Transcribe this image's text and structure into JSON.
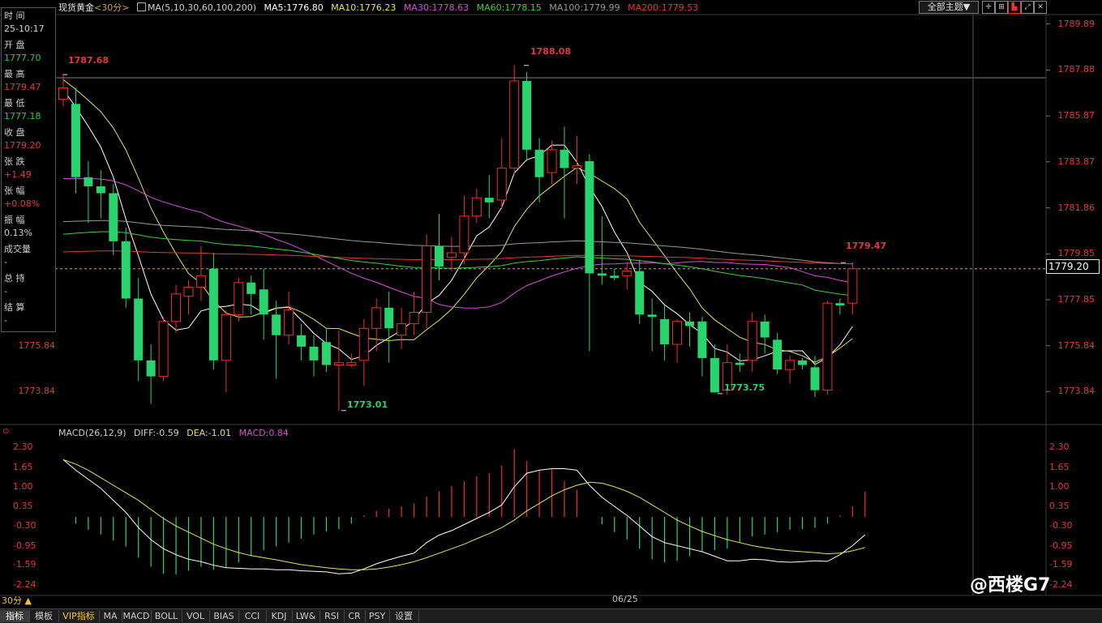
{
  "instrument": "现货黄金",
  "period_tag": "<30分>",
  "legend": {
    "ma_header": "MA(5,10,30,60,100,200)",
    "items": [
      {
        "label": "MA5:1776.80",
        "color": "#ffffff"
      },
      {
        "label": "MA10:1776.23",
        "color": "#e8e35c"
      },
      {
        "label": "MA30:1778.63",
        "color": "#d84fd8"
      },
      {
        "label": "MA60:1778.15",
        "color": "#3fcf3f"
      },
      {
        "label": "MA100:1779.99",
        "color": "#9a9a9a"
      },
      {
        "label": "MA200:1779.53",
        "color": "#e03a3a"
      }
    ]
  },
  "theme_button": "全部主题▼",
  "info_panel": {
    "rows": [
      {
        "label": "时 间",
        "value": "25-10:17",
        "color": "#d0d0d0"
      },
      {
        "label": "开 盘",
        "value": "1777.70",
        "color": "#33cc33"
      },
      {
        "label": "最 高",
        "value": "1779.47",
        "color": "#e03a3a"
      },
      {
        "label": "最 低",
        "value": "1777.18",
        "color": "#33cc33"
      },
      {
        "label": "收 盘",
        "value": "1779.20",
        "color": "#e03a3a"
      },
      {
        "label": "张 跌",
        "value": "+1.49",
        "color": "#e03a3a"
      },
      {
        "label": "张 幅",
        "value": "+0.08%",
        "color": "#e03a3a"
      },
      {
        "label": "振 幅",
        "value": "0.13%",
        "color": "#d0d0d0"
      },
      {
        "label": "成交量",
        "value": "-",
        "color": "#d0d0d0"
      },
      {
        "label": "总 持",
        "value": "-",
        "color": "#d0d0d0"
      },
      {
        "label": "结 算",
        "value": "-",
        "color": "#d0d0d0"
      }
    ]
  },
  "price_axis": [
    "1789.89",
    "1787.88",
    "1785.87",
    "1783.87",
    "1781.86",
    "1779.85",
    "1777.85",
    "1775.84",
    "1773.84"
  ],
  "current_price": "1779.20",
  "annotations": {
    "high_left": "1787.68",
    "high_mid": "1788.08",
    "low_left": "1773.01",
    "low_right": "1773.75",
    "last_high": "1779.47"
  },
  "macd": {
    "header": "MACD(26,12,9)",
    "diff": "DIFF:-0.59",
    "dea": "DEA:-1.01",
    "macd": "MACD:0.84",
    "axis": [
      "2.30",
      "1.65",
      "1.00",
      "0.35",
      "-0.30",
      "-0.95",
      "-1.59",
      "-2.24"
    ]
  },
  "date_label": "06/25",
  "period_label": "30分 ▲",
  "tabs": [
    "指标",
    "模板",
    "VIP指标",
    "MA",
    "MACD",
    "BOLL",
    "VOL",
    "BIAS",
    "CCI",
    "KDJ",
    "LW&",
    "RSI",
    "CR",
    "PSY",
    "设置"
  ],
  "watermark": "@西楼G7",
  "chart_data": {
    "type": "candlestick",
    "title": "现货黄金 30分",
    "price_range": [
      1772.4,
      1790.3
    ],
    "candles": [
      {
        "o": 1786.6,
        "h": 1787.7,
        "c": 1787.1,
        "l": 1786.3
      },
      {
        "o": 1786.4,
        "h": 1787.1,
        "c": 1783.2,
        "l": 1782.5
      },
      {
        "o": 1783.2,
        "h": 1783.9,
        "c": 1782.8,
        "l": 1781.2
      },
      {
        "o": 1782.8,
        "h": 1783.5,
        "c": 1782.5,
        "l": 1781.4
      },
      {
        "o": 1782.5,
        "h": 1782.9,
        "c": 1780.4,
        "l": 1779.8
      },
      {
        "o": 1780.4,
        "h": 1781.0,
        "c": 1777.9,
        "l": 1777.5
      },
      {
        "o": 1777.9,
        "h": 1778.8,
        "c": 1775.2,
        "l": 1774.3
      },
      {
        "o": 1775.2,
        "h": 1775.9,
        "c": 1774.5,
        "l": 1773.3
      },
      {
        "o": 1774.5,
        "h": 1777.1,
        "c": 1776.9,
        "l": 1774.3
      },
      {
        "o": 1776.9,
        "h": 1778.5,
        "c": 1778.1,
        "l": 1776.4
      },
      {
        "o": 1778.0,
        "h": 1778.7,
        "c": 1778.4,
        "l": 1777.2
      },
      {
        "o": 1778.4,
        "h": 1780.2,
        "c": 1778.9,
        "l": 1777.8
      },
      {
        "o": 1779.2,
        "h": 1779.9,
        "c": 1775.2,
        "l": 1774.8
      },
      {
        "o": 1775.2,
        "h": 1777.4,
        "c": 1777.2,
        "l": 1773.8
      },
      {
        "o": 1777.2,
        "h": 1778.8,
        "c": 1778.6,
        "l": 1776.9
      },
      {
        "o": 1778.6,
        "h": 1778.9,
        "c": 1778.1,
        "l": 1777.2
      },
      {
        "o": 1778.3,
        "h": 1779.2,
        "c": 1777.2,
        "l": 1776.1
      },
      {
        "o": 1777.2,
        "h": 1777.8,
        "c": 1776.3,
        "l": 1774.4
      },
      {
        "o": 1776.3,
        "h": 1778.2,
        "c": 1777.4,
        "l": 1775.9
      },
      {
        "o": 1776.3,
        "h": 1776.8,
        "c": 1775.8,
        "l": 1775.2
      },
      {
        "o": 1775.8,
        "h": 1776.3,
        "c": 1775.2,
        "l": 1774.5
      },
      {
        "o": 1776.0,
        "h": 1776.6,
        "c": 1775.0,
        "l": 1774.7
      },
      {
        "o": 1775.0,
        "h": 1776.5,
        "c": 1775.1,
        "l": 1773.0
      },
      {
        "o": 1775.0,
        "h": 1775.5,
        "c": 1775.1,
        "l": 1774.9
      },
      {
        "o": 1775.2,
        "h": 1777.0,
        "c": 1776.6,
        "l": 1774.1
      },
      {
        "o": 1776.6,
        "h": 1777.9,
        "c": 1777.5,
        "l": 1775.6
      },
      {
        "o": 1777.5,
        "h": 1778.2,
        "c": 1776.6,
        "l": 1775.1
      },
      {
        "o": 1776.3,
        "h": 1777.5,
        "c": 1776.8,
        "l": 1775.7
      },
      {
        "o": 1776.8,
        "h": 1778.2,
        "c": 1777.3,
        "l": 1776.3
      },
      {
        "o": 1777.3,
        "h": 1780.7,
        "c": 1780.2,
        "l": 1776.6
      },
      {
        "o": 1780.2,
        "h": 1781.6,
        "c": 1779.3,
        "l": 1778.7
      },
      {
        "o": 1779.7,
        "h": 1780.6,
        "c": 1779.9,
        "l": 1779.1
      },
      {
        "o": 1779.9,
        "h": 1782.4,
        "c": 1781.5,
        "l": 1779.4
      },
      {
        "o": 1781.5,
        "h": 1782.7,
        "c": 1782.3,
        "l": 1781.2
      },
      {
        "o": 1782.3,
        "h": 1783.3,
        "c": 1782.1,
        "l": 1781.4
      },
      {
        "o": 1782.2,
        "h": 1784.9,
        "c": 1783.6,
        "l": 1781.8
      },
      {
        "o": 1783.6,
        "h": 1788.1,
        "c": 1787.4,
        "l": 1783.3
      },
      {
        "o": 1787.4,
        "h": 1787.8,
        "c": 1784.4,
        "l": 1783.9
      },
      {
        "o": 1784.4,
        "h": 1784.9,
        "c": 1783.2,
        "l": 1782.1
      },
      {
        "o": 1783.4,
        "h": 1784.8,
        "c": 1784.4,
        "l": 1782.9
      },
      {
        "o": 1784.4,
        "h": 1785.4,
        "c": 1783.6,
        "l": 1781.4
      },
      {
        "o": 1783.6,
        "h": 1785.0,
        "c": 1783.7,
        "l": 1782.9
      },
      {
        "o": 1783.9,
        "h": 1784.2,
        "c": 1779.0,
        "l": 1775.6
      },
      {
        "o": 1779.0,
        "h": 1781.5,
        "c": 1778.9,
        "l": 1778.5
      },
      {
        "o": 1778.9,
        "h": 1779.2,
        "c": 1778.8,
        "l": 1778.7
      },
      {
        "o": 1778.9,
        "h": 1779.5,
        "c": 1779.1,
        "l": 1778.3
      },
      {
        "o": 1779.1,
        "h": 1779.6,
        "c": 1777.2,
        "l": 1776.8
      },
      {
        "o": 1777.2,
        "h": 1777.9,
        "c": 1777.1,
        "l": 1775.6
      },
      {
        "o": 1777.0,
        "h": 1777.6,
        "c": 1775.9,
        "l": 1775.2
      },
      {
        "o": 1775.9,
        "h": 1777.0,
        "c": 1776.9,
        "l": 1775.1
      },
      {
        "o": 1776.9,
        "h": 1777.3,
        "c": 1776.7,
        "l": 1775.8
      },
      {
        "o": 1776.9,
        "h": 1777.1,
        "c": 1775.3,
        "l": 1774.5
      },
      {
        "o": 1775.3,
        "h": 1775.9,
        "c": 1773.8,
        "l": 1773.8
      },
      {
        "o": 1773.9,
        "h": 1775.9,
        "c": 1775.1,
        "l": 1773.7
      },
      {
        "o": 1775.1,
        "h": 1775.5,
        "c": 1775.0,
        "l": 1774.7
      },
      {
        "o": 1775.2,
        "h": 1777.3,
        "c": 1776.9,
        "l": 1774.7
      },
      {
        "o": 1776.9,
        "h": 1777.2,
        "c": 1776.2,
        "l": 1775.5
      },
      {
        "o": 1776.1,
        "h": 1776.4,
        "c": 1774.8,
        "l": 1774.6
      },
      {
        "o": 1774.8,
        "h": 1775.4,
        "c": 1775.2,
        "l": 1774.2
      },
      {
        "o": 1775.2,
        "h": 1775.3,
        "c": 1775.0,
        "l": 1774.8
      },
      {
        "o": 1774.9,
        "h": 1775.4,
        "c": 1773.9,
        "l": 1773.6
      },
      {
        "o": 1773.9,
        "h": 1777.8,
        "c": 1777.7,
        "l": 1773.7
      },
      {
        "o": 1777.7,
        "h": 1777.9,
        "c": 1777.6,
        "l": 1777.2
      },
      {
        "o": 1777.7,
        "h": 1779.5,
        "c": 1779.2,
        "l": 1777.2
      }
    ],
    "macd_range": [
      -2.6,
      2.5
    ],
    "macd_hist": [
      0.0,
      -0.22,
      -0.42,
      -0.58,
      -0.78,
      -0.98,
      -1.35,
      -1.65,
      -1.88,
      -1.9,
      -1.78,
      -1.65,
      -1.75,
      -1.68,
      -1.5,
      -1.3,
      -1.1,
      -0.98,
      -0.85,
      -0.72,
      -0.58,
      -0.48,
      -0.4,
      -0.22,
      0.05,
      0.2,
      0.28,
      0.35,
      0.45,
      0.68,
      0.85,
      1.02,
      1.18,
      1.35,
      1.45,
      1.7,
      2.25,
      1.85,
      1.55,
      1.6,
      1.2,
      0.9,
      0.0,
      -0.25,
      -0.5,
      -0.75,
      -1.05,
      -1.4,
      -1.5,
      -1.45,
      -1.3,
      -1.15,
      -1.1,
      -1.05,
      -0.85,
      -0.65,
      -0.58,
      -0.5,
      -0.42,
      -0.4,
      -0.36,
      -0.22,
      0.05,
      0.35,
      0.84
    ],
    "diff": [
      1.9,
      1.55,
      1.25,
      0.95,
      0.55,
      0.15,
      -0.35,
      -0.75,
      -1.05,
      -1.25,
      -1.4,
      -1.48,
      -1.6,
      -1.68,
      -1.7,
      -1.72,
      -1.72,
      -1.75,
      -1.75,
      -1.78,
      -1.8,
      -1.82,
      -1.88,
      -1.86,
      -1.72,
      -1.55,
      -1.42,
      -1.3,
      -1.2,
      -0.85,
      -0.6,
      -0.45,
      -0.25,
      -0.05,
      0.15,
      0.4,
      1.0,
      1.45,
      1.55,
      1.6,
      1.6,
      1.55,
      1.05,
      0.65,
      0.35,
      0.05,
      -0.3,
      -0.65,
      -0.85,
      -0.95,
      -1.05,
      -1.15,
      -1.3,
      -1.45,
      -1.45,
      -1.4,
      -1.42,
      -1.48,
      -1.5,
      -1.48,
      -1.45,
      -1.47,
      -1.25,
      -0.95,
      -0.59
    ],
    "dea": [
      1.9,
      1.75,
      1.55,
      1.3,
      1.05,
      0.8,
      0.55,
      0.25,
      -0.05,
      -0.3,
      -0.5,
      -0.7,
      -0.9,
      -1.05,
      -1.18,
      -1.28,
      -1.35,
      -1.42,
      -1.5,
      -1.58,
      -1.63,
      -1.68,
      -1.72,
      -1.75,
      -1.75,
      -1.72,
      -1.66,
      -1.58,
      -1.48,
      -1.35,
      -1.2,
      -1.05,
      -0.9,
      -0.72,
      -0.55,
      -0.35,
      -0.1,
      0.2,
      0.45,
      0.7,
      0.9,
      1.05,
      1.15,
      1.12,
      1.0,
      0.85,
      0.65,
      0.4,
      0.15,
      -0.1,
      -0.3,
      -0.48,
      -0.62,
      -0.75,
      -0.85,
      -0.95,
      -1.02,
      -1.08,
      -1.12,
      -1.15,
      -1.18,
      -1.22,
      -1.2,
      -1.12,
      -1.01
    ]
  }
}
